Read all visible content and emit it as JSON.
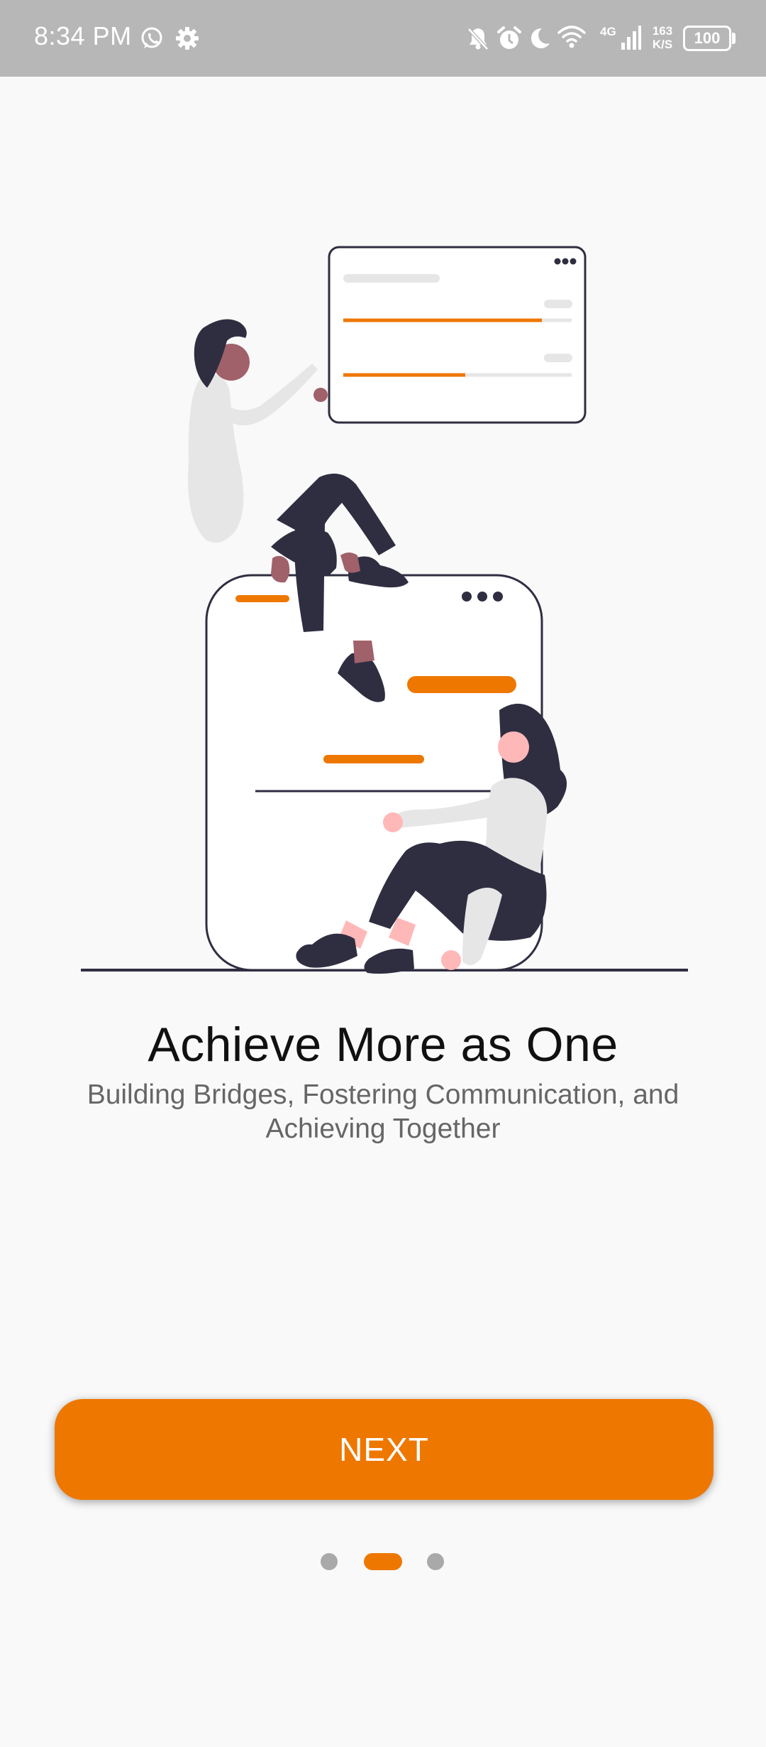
{
  "status_bar": {
    "time": "8:34 PM",
    "net_speed_value": "163",
    "net_speed_unit": "K/S",
    "network_type": "4G",
    "battery": "100",
    "icons": [
      "whatsapp-icon",
      "settings-gear-icon",
      "notifications-muted-icon",
      "alarm-icon",
      "do-not-disturb-moon-icon",
      "wifi-icon",
      "cellular-signal-icon",
      "battery-icon"
    ]
  },
  "onboarding": {
    "title": "Achieve More as One",
    "subtitle": "Building Bridges, Fostering Communication, and Achieving Together",
    "next_label": "NEXT",
    "current_page": 2,
    "total_pages": 3
  },
  "colors": {
    "accent": "#ee7700",
    "status_bar": "#b7b7b7",
    "background": "#f9f9f9",
    "dot_inactive": "#a9a9a9",
    "illustration_dark": "#2f2e41"
  }
}
